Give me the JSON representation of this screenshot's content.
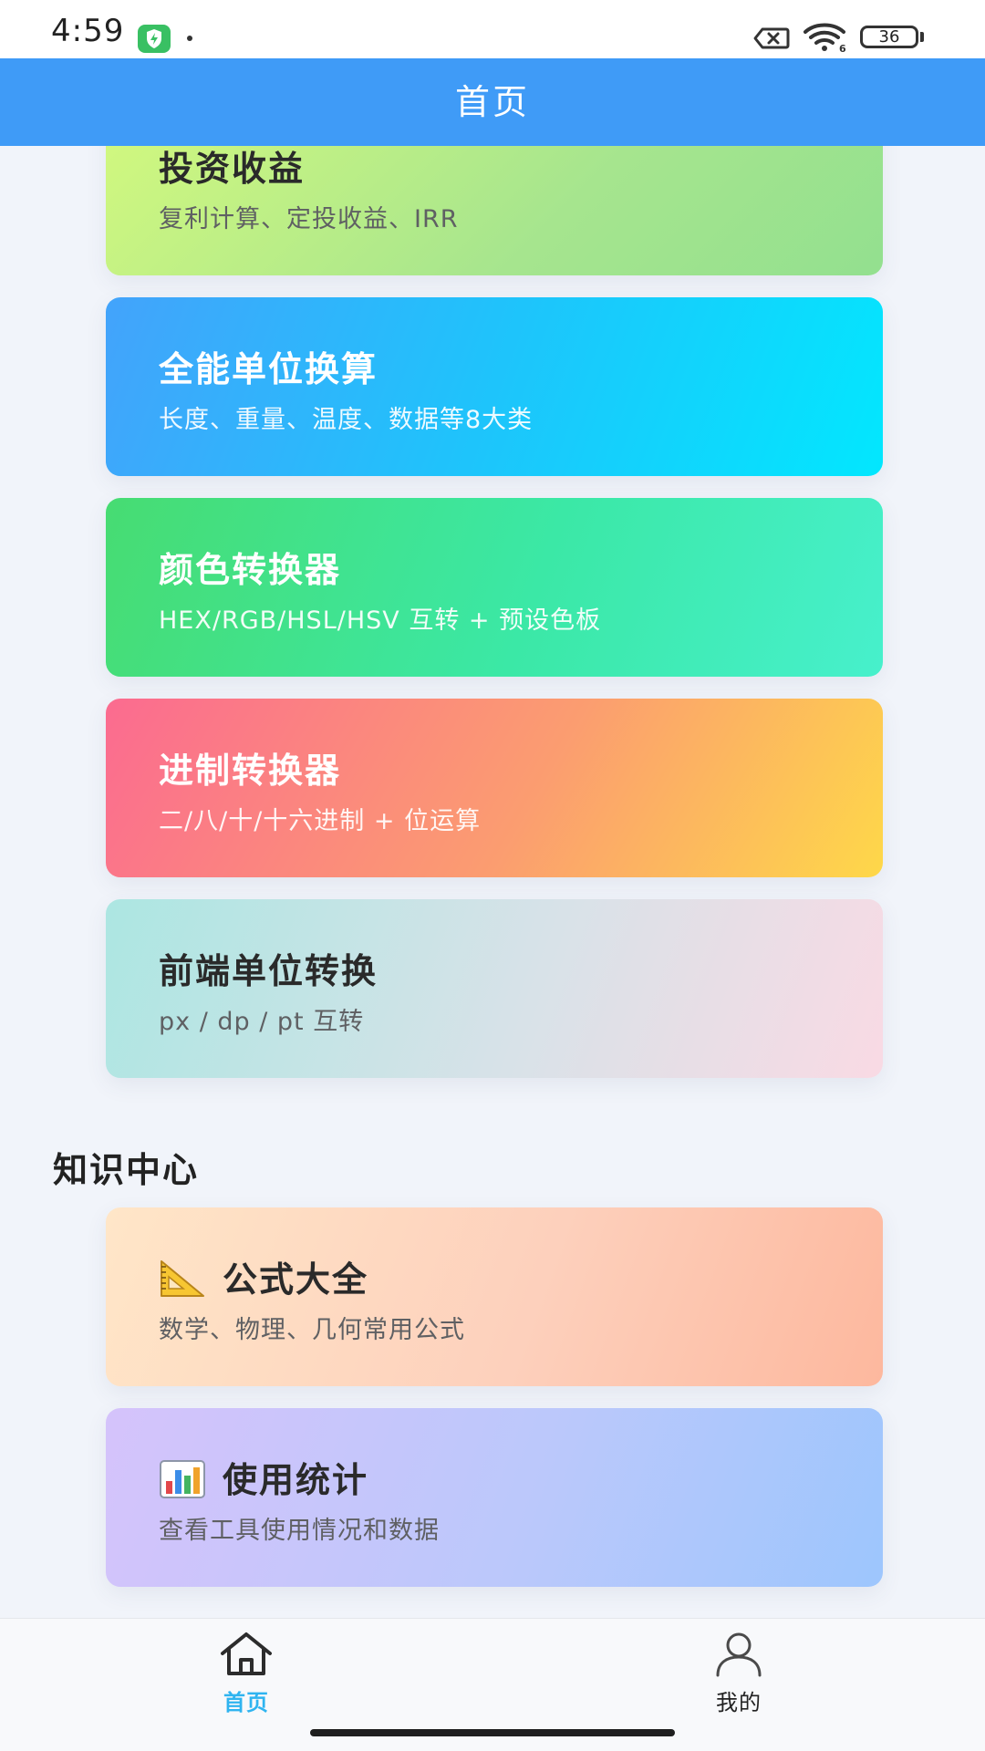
{
  "status_bar": {
    "time": "4:59",
    "battery": "36"
  },
  "header": {
    "title": "首页"
  },
  "tools": [
    {
      "title": "投资收益",
      "subtitle": "复利计算、定投收益、IRR"
    },
    {
      "title": "全能单位换算",
      "subtitle": "长度、重量、温度、数据等8大类"
    },
    {
      "title": "颜色转换器",
      "subtitle": "HEX/RGB/HSL/HSV 互转 + 预设色板"
    },
    {
      "title": "进制转换器",
      "subtitle": "二/八/十/十六进制 + 位运算"
    },
    {
      "title": "前端单位转换",
      "subtitle": "px / dp / pt 互转"
    }
  ],
  "knowledge": {
    "section_title": "知识中心",
    "items": [
      {
        "icon": "triangular-ruler-icon",
        "title": "公式大全",
        "subtitle": "数学、物理、几何常用公式"
      },
      {
        "icon": "bar-chart-icon",
        "title": "使用统计",
        "subtitle": "查看工具使用情况和数据"
      }
    ]
  },
  "bottom_nav": {
    "items": [
      {
        "icon": "home-icon",
        "label": "首页",
        "active": true
      },
      {
        "icon": "user-icon",
        "label": "我的",
        "active": false
      }
    ]
  },
  "colors": {
    "header": "#3f9bf7",
    "active_tab": "#2fb4f0",
    "background": "#f1f4fa"
  }
}
